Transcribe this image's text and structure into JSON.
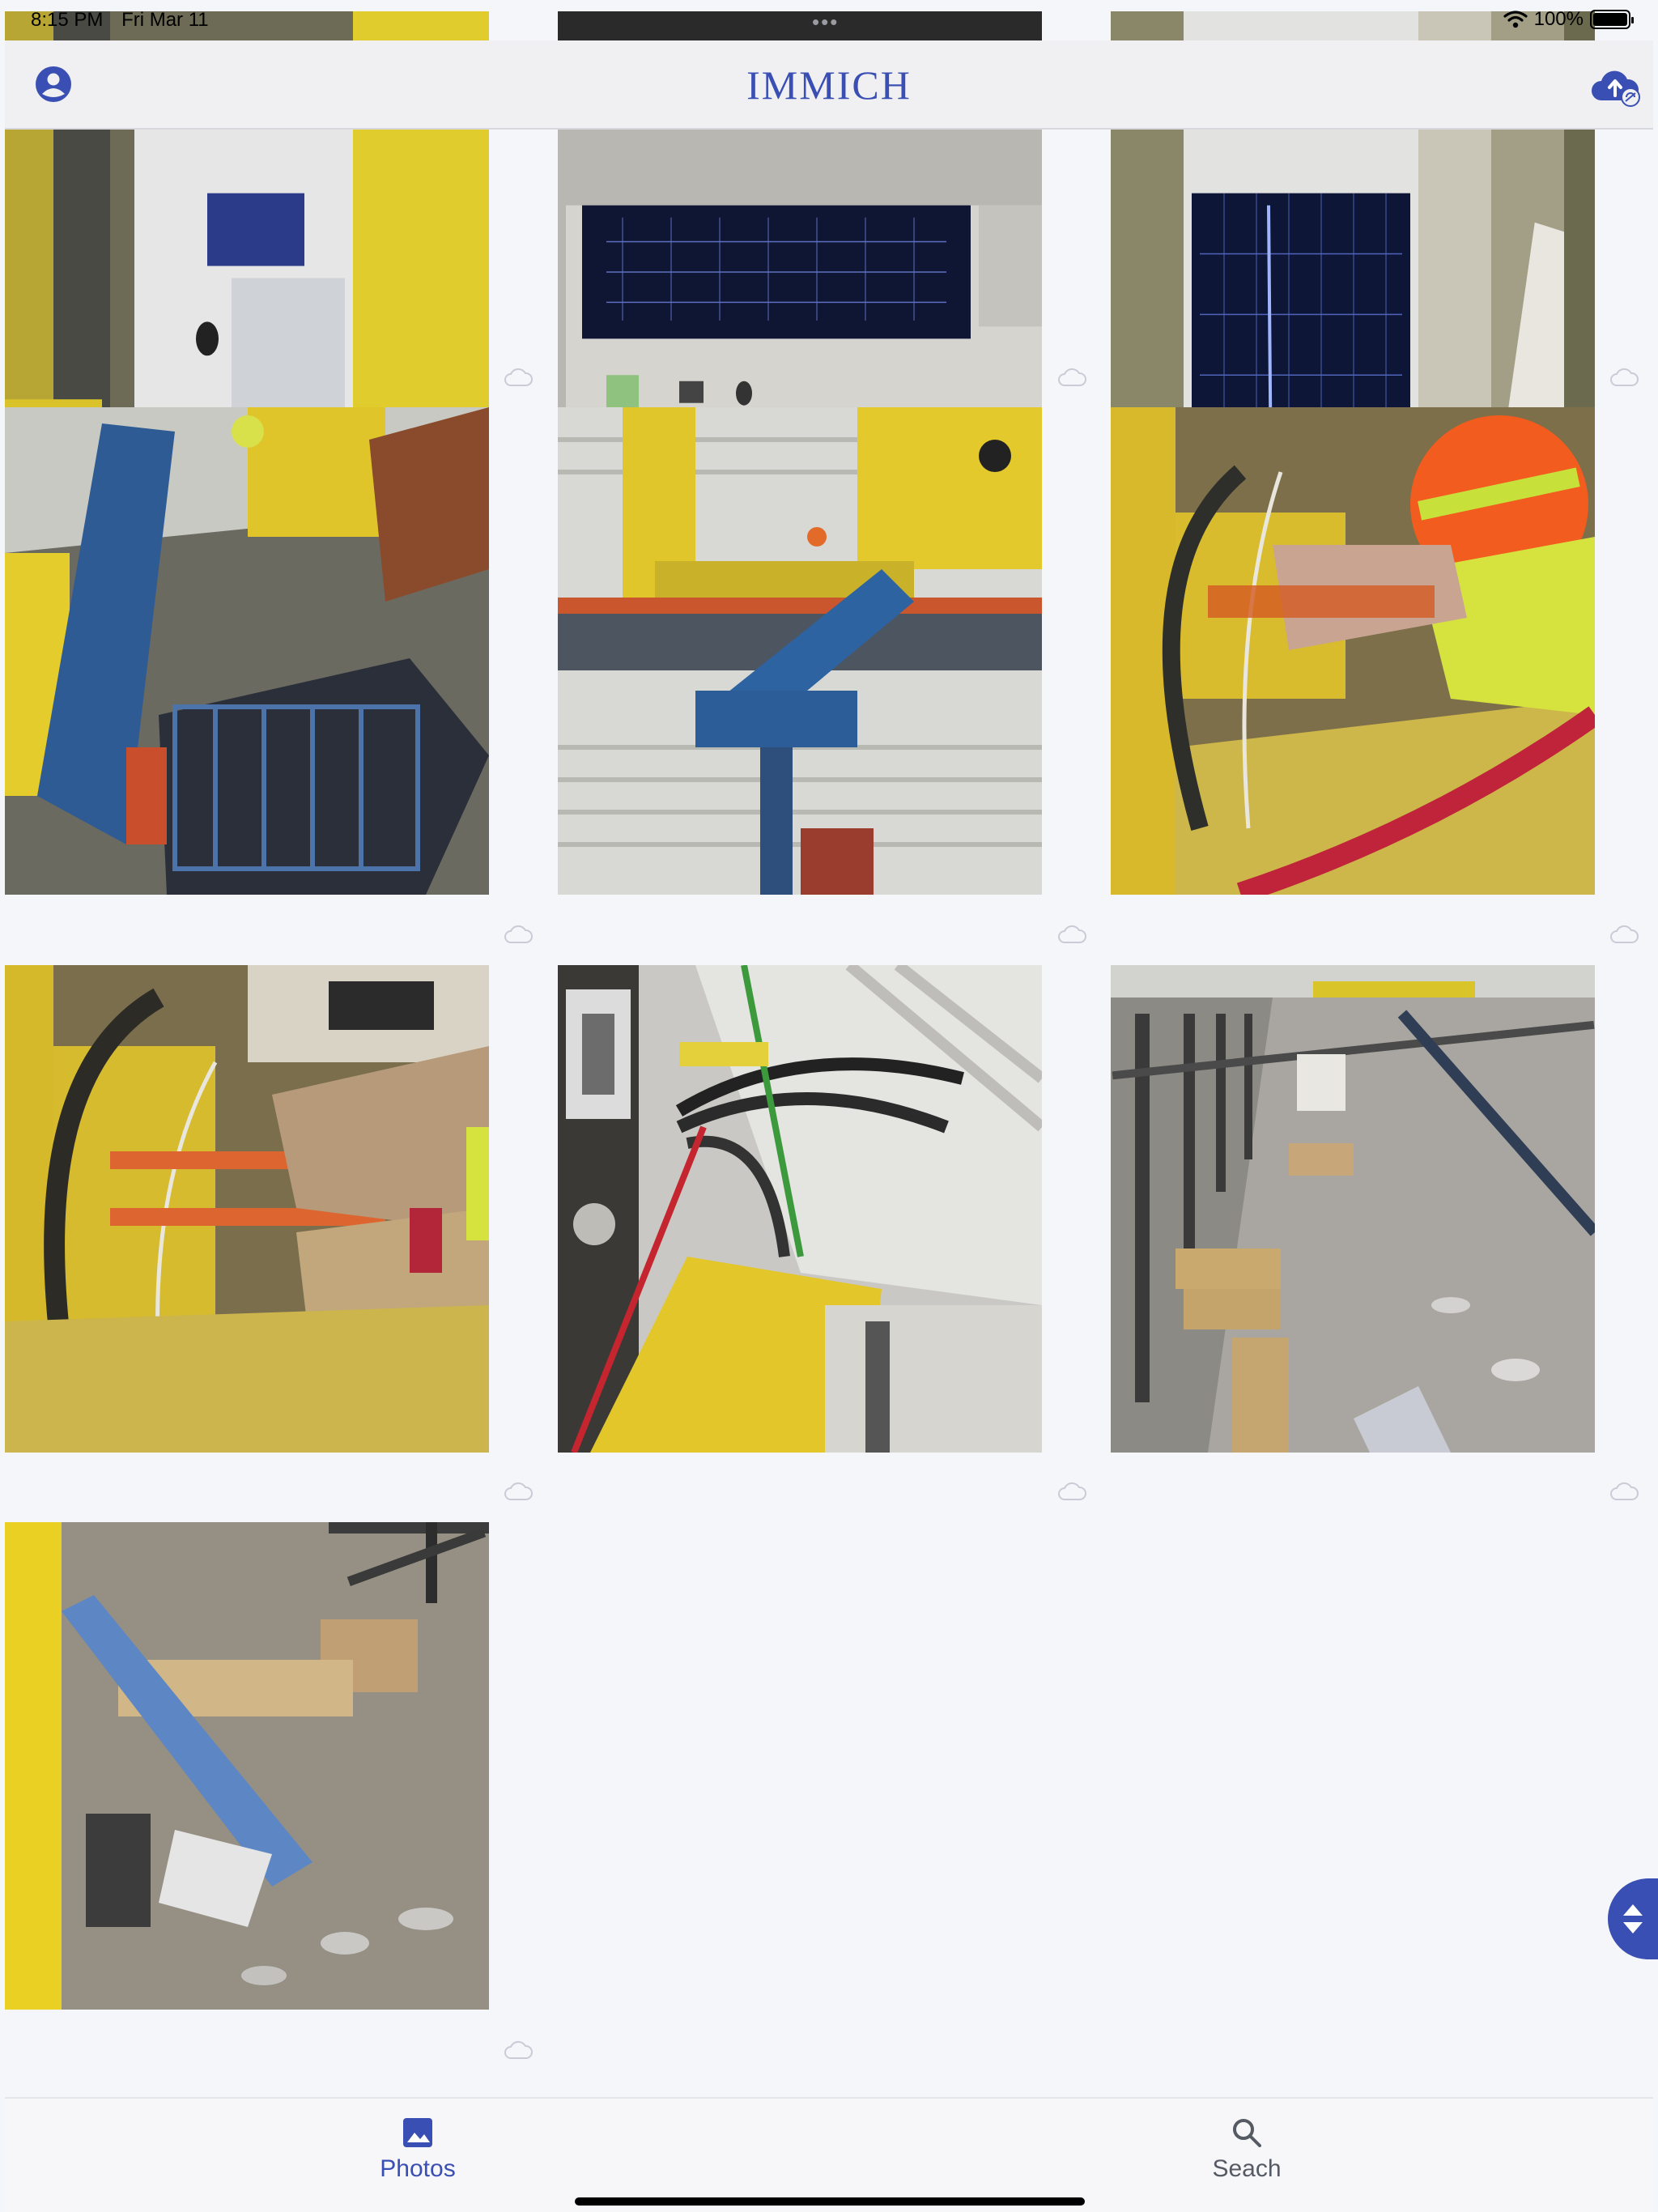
{
  "status_bar": {
    "time": "8:15 PM",
    "date": "Fri Mar 11",
    "multitask_indicator": "•••",
    "battery_percent": "100%",
    "battery_level": 1.0,
    "wifi_icon": "wifi-icon",
    "battery_icon": "battery-icon"
  },
  "app_bar": {
    "title": "IMMICH",
    "account_icon": "account-circle-icon",
    "upload_icon": "cloud-upload-icon"
  },
  "colors": {
    "accent": "#3a4fb3",
    "background": "#f5f6fa",
    "app_bar": "#f0f0f2",
    "inactive": "#555a63",
    "cloud_badge": "#c9ccd6"
  },
  "photos": [
    {
      "subject": "signal-generator",
      "backup_status_icon": "cloud-icon"
    },
    {
      "subject": "spectrum-analyzer",
      "backup_status_icon": "cloud-icon"
    },
    {
      "subject": "analyzer-screen",
      "backup_status_icon": "cloud-icon"
    },
    {
      "subject": "boom-lift-basket",
      "backup_status_icon": "cloud-icon"
    },
    {
      "subject": "crane-beam-below",
      "backup_status_icon": "cloud-icon"
    },
    {
      "subject": "worker-hard-hat",
      "backup_status_icon": "cloud-icon"
    },
    {
      "subject": "cable-wiring",
      "backup_status_icon": "cloud-icon"
    },
    {
      "subject": "qr-tag-cables",
      "backup_status_icon": "cloud-icon"
    },
    {
      "subject": "warehouse-floor",
      "backup_status_icon": "cloud-icon"
    },
    {
      "subject": "lift-and-lumber",
      "backup_status_icon": "cloud-icon"
    }
  ],
  "scroll_handle_icon": "scroll-arrows-icon",
  "bottom_nav": {
    "items": [
      {
        "label": "Photos",
        "icon": "photo-icon",
        "active": true
      },
      {
        "label": "Seach",
        "icon": "search-icon",
        "active": false
      }
    ]
  }
}
